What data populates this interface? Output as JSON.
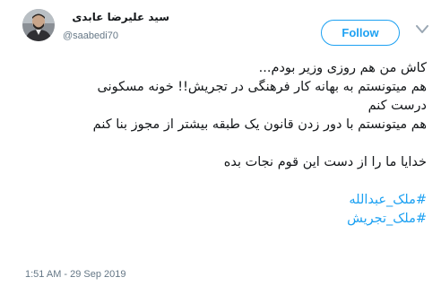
{
  "author": {
    "display_name": "سید علیرضا عابدی",
    "handle": "@saabedi70",
    "avatar_icon": "person-avatar"
  },
  "follow_button": {
    "label": "Follow"
  },
  "menu_icon": "chevron-down-icon",
  "tweet": {
    "lines": [
      "کاش من هم روزی وزیر بودم...",
      "هم میتونستم به بهانه کار فرهنگی در تجریش!! خونه مسکونی",
      "درست کنم",
      "هم میتونستم با دور زدن قانون یک طبقه بیشتر از مجوز بنا کنم",
      "خدایا ما را از دست این قوم نجات بده"
    ],
    "hashtags": [
      "#ملک_عبدالله",
      "#ملک_تجریش"
    ],
    "timestamp": "1:51 AM - 29 Sep 2019"
  },
  "colors": {
    "accent": "#1da1f2",
    "text": "#14171a",
    "muted": "#657786"
  }
}
